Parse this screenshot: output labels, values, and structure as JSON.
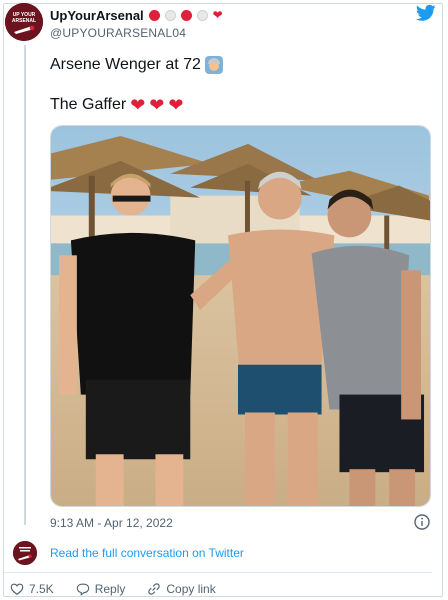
{
  "user": {
    "display_name": "UpYourArsenal",
    "handle": "@UPYOURARSENAL04",
    "avatar_text": "UP YOUR ARSENAL"
  },
  "tweet": {
    "line1": "Arsene Wenger at 72",
    "line2": "The Gaffer",
    "timestamp": "9:13 AM - Apr 12, 2022"
  },
  "footer": {
    "read_link": "Read the full conversation on Twitter",
    "likes": "7.5K",
    "reply_label": "Reply",
    "copy_link_label": "Copy link"
  },
  "icons": {
    "brand": "twitter-bird-icon",
    "info": "info-icon",
    "like": "heart-icon",
    "reply": "reply-bubble-icon",
    "copy": "link-icon"
  },
  "colors": {
    "brand_blue": "#1d9bf0",
    "arsenal_red": "#e0203a",
    "text_gray": "#536471",
    "avatar_bg": "#6b1420"
  }
}
